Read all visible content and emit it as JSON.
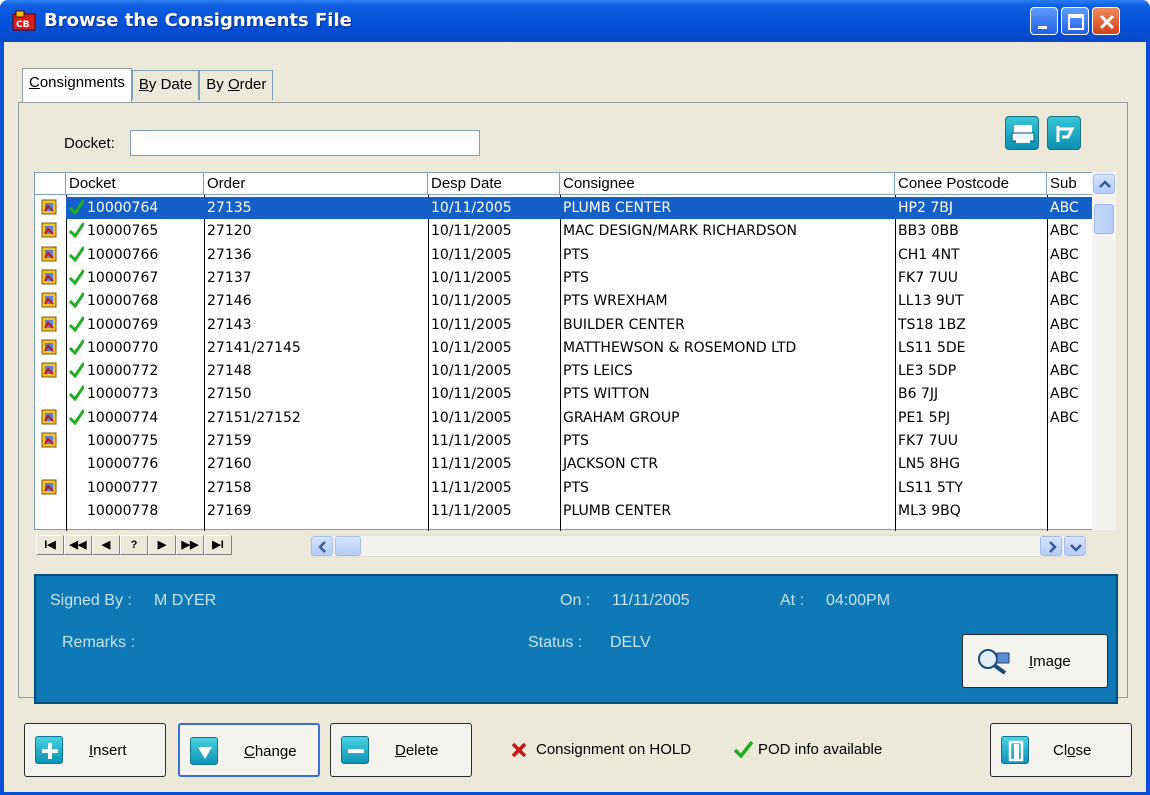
{
  "window": {
    "title": "Browse the Consignments File"
  },
  "tabs": [
    {
      "label": "Consignments",
      "underline": "C",
      "rest": "onsignments"
    },
    {
      "label": "By Date",
      "underline": "B",
      "rest": "y Date"
    },
    {
      "label": "By Order",
      "pre": "By ",
      "underline": "O",
      "rest": "rder"
    }
  ],
  "search": {
    "label": "Docket:",
    "value": ""
  },
  "grid": {
    "columns": [
      "Docket",
      "Order",
      "Desp Date",
      "Consignee",
      "Conee Postcode",
      "Sub"
    ],
    "rows": [
      {
        "attach": true,
        "pod": true,
        "docket": "10000764",
        "order": "27135",
        "date": "10/11/2005",
        "consignee": "PLUMB CENTER",
        "postcode": "HP2 7BJ",
        "sub": "ABC",
        "selected": true
      },
      {
        "attach": true,
        "pod": true,
        "docket": "10000765",
        "order": "27120",
        "date": "10/11/2005",
        "consignee": "MAC DESIGN/MARK RICHARDSON",
        "postcode": "BB3 0BB",
        "sub": "ABC"
      },
      {
        "attach": true,
        "pod": true,
        "docket": "10000766",
        "order": "27136",
        "date": "10/11/2005",
        "consignee": "PTS",
        "postcode": "CH1 4NT",
        "sub": "ABC"
      },
      {
        "attach": true,
        "pod": true,
        "docket": "10000767",
        "order": "27137",
        "date": "10/11/2005",
        "consignee": "PTS",
        "postcode": "FK7 7UU",
        "sub": "ABC"
      },
      {
        "attach": true,
        "pod": true,
        "docket": "10000768",
        "order": "27146",
        "date": "10/11/2005",
        "consignee": "PTS WREXHAM",
        "postcode": "LL13 9UT",
        "sub": "ABC"
      },
      {
        "attach": true,
        "pod": true,
        "docket": "10000769",
        "order": "27143",
        "date": "10/11/2005",
        "consignee": "BUILDER CENTER",
        "postcode": "TS18 1BZ",
        "sub": "ABC"
      },
      {
        "attach": true,
        "pod": true,
        "docket": "10000770",
        "order": "27141/27145",
        "date": "10/11/2005",
        "consignee": "MATTHEWSON & ROSEMOND LTD",
        "postcode": "LS11 5DE",
        "sub": "ABC"
      },
      {
        "attach": true,
        "pod": true,
        "docket": "10000772",
        "order": "27148",
        "date": "10/11/2005",
        "consignee": "PTS LEICS",
        "postcode": "LE3 5DP",
        "sub": "ABC"
      },
      {
        "attach": false,
        "pod": true,
        "docket": "10000773",
        "order": "27150",
        "date": "10/11/2005",
        "consignee": "PTS WITTON",
        "postcode": "B6 7JJ",
        "sub": "ABC"
      },
      {
        "attach": true,
        "pod": true,
        "docket": "10000774",
        "order": "27151/27152",
        "date": "10/11/2005",
        "consignee": "GRAHAM GROUP",
        "postcode": "PE1 5PJ",
        "sub": "ABC"
      },
      {
        "attach": true,
        "pod": false,
        "docket": "10000775",
        "order": "27159",
        "date": "11/11/2005",
        "consignee": "PTS",
        "postcode": "FK7 7UU",
        "sub": ""
      },
      {
        "attach": false,
        "pod": false,
        "docket": "10000776",
        "order": "27160",
        "date": "11/11/2005",
        "consignee": "JACKSON CTR",
        "postcode": "LN5 8HG",
        "sub": ""
      },
      {
        "attach": true,
        "pod": false,
        "docket": "10000777",
        "order": "27158",
        "date": "11/11/2005",
        "consignee": "PTS",
        "postcode": "LS11 5TY",
        "sub": ""
      },
      {
        "attach": false,
        "pod": false,
        "docket": "10000778",
        "order": "27169",
        "date": "11/11/2005",
        "consignee": "PLUMB CENTER",
        "postcode": "ML3 9BQ",
        "sub": ""
      }
    ]
  },
  "navigator": [
    "I◀",
    "◀◀",
    "◀",
    "?",
    "▶",
    "▶▶",
    "▶I"
  ],
  "details": {
    "signed_by_label": "Signed By :",
    "signed_by": "M DYER",
    "on_label": "On :",
    "on": "11/11/2005",
    "at_label": "At :",
    "at": "04:00PM",
    "remarks_label": "Remarks :",
    "status_label": "Status :",
    "status": "DELV",
    "image_button": {
      "underline": "I",
      "rest": "mage"
    }
  },
  "buttons": {
    "insert": {
      "underline": "I",
      "rest": "nsert"
    },
    "change": {
      "underline": "C",
      "rest": "hange"
    },
    "delete": {
      "underline": "D",
      "rest": "elete"
    },
    "close": {
      "pre": "Cl",
      "underline": "o",
      "rest": "se"
    }
  },
  "legend": {
    "hold": "Consignment on HOLD",
    "pod": "POD info available"
  },
  "colors": {
    "selection": "#1460c8",
    "info_panel": "#0f79b5",
    "check": "#1fae1f",
    "hold_x": "#c81414"
  }
}
